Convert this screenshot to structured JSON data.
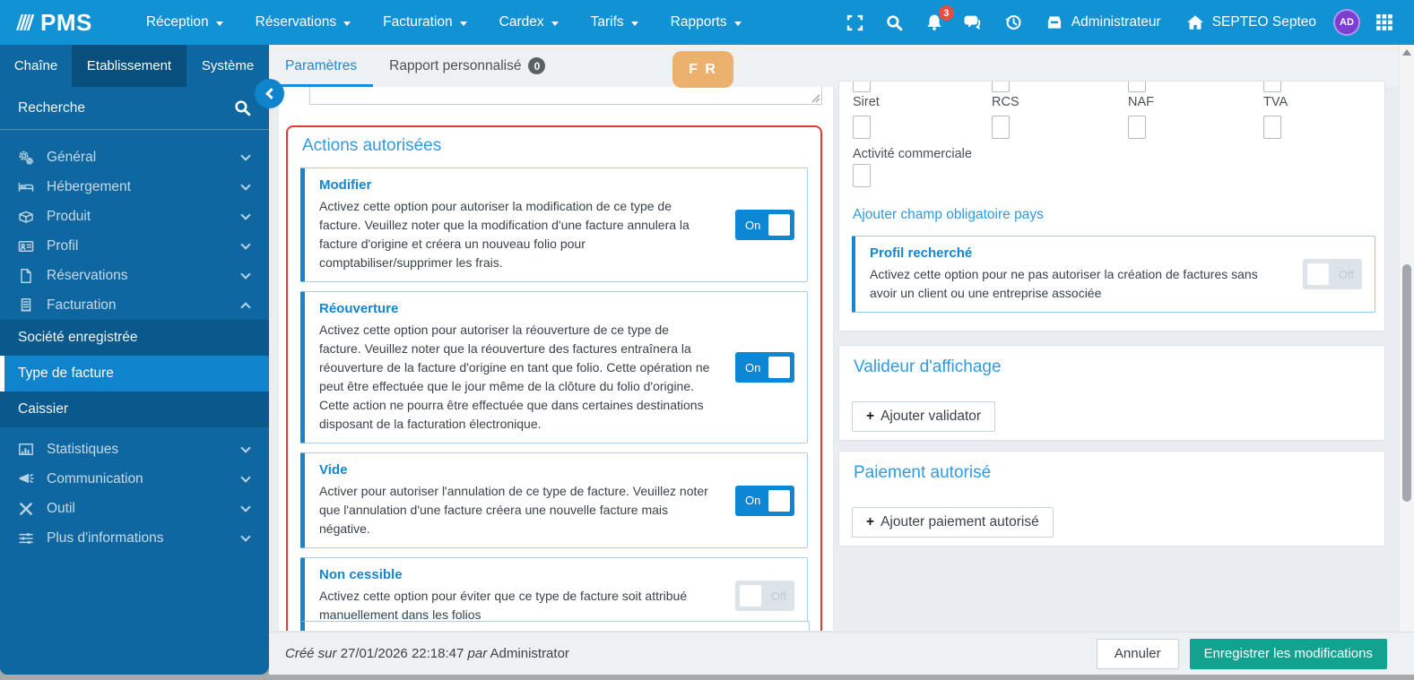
{
  "colors": {
    "navbar_blue": "#1092d4",
    "sidebar_blue": "#0e67a0",
    "accent_blue": "#1486d0",
    "section_title_blue": "#2e9be2",
    "red_highlight": "#e53935",
    "save_teal": "#13a290",
    "language_badge_orange": "#ecb26d",
    "notification_red": "#e84c3d",
    "avatar_purple": "#7a3fd1"
  },
  "icons": {
    "logo-stripes": "diagonal-bars",
    "fullscreen": "corner-brackets",
    "search": "magnifier",
    "notifications": "bell",
    "messages": "chat-bubbles",
    "history": "clock-arrow",
    "user": "inbox-tray",
    "property": "home",
    "apps": "grid-3x3",
    "general": "gears",
    "hebergement": "bed",
    "produit": "open-box",
    "profil": "id-card",
    "reservations": "file",
    "facturation": "receipt",
    "statistiques": "bar-chart",
    "communication": "megaphone",
    "outil": "crossed-tools",
    "plus-informations": "sliders"
  },
  "navbar": {
    "logo_text": "PMS",
    "menus": [
      "Réception",
      "Réservations",
      "Facturation",
      "Cardex",
      "Tarifs",
      "Rapports"
    ],
    "notification_count": "3",
    "user_label": "Administrateur",
    "property_label": "SEPTEO Septeo",
    "avatar_initials": "AD"
  },
  "sidebar": {
    "tabs": [
      "Chaîne",
      "Etablissement",
      "Système"
    ],
    "search_placeholder": "Recherche",
    "items": [
      "Général",
      "Hébergement",
      "Produit",
      "Profil",
      "Réservations",
      "Facturation",
      "Statistiques",
      "Communication",
      "Outil",
      "Plus d'informations"
    ],
    "facturation_children": [
      "Société enregistrée",
      "Type de facture",
      "Caissier"
    ]
  },
  "content_tabs": {
    "parametres": "Paramètres",
    "rapport": "Rapport personnalisé",
    "rapport_badge": "0"
  },
  "language_badge": "F R",
  "actions": {
    "title": "Actions autorisées",
    "cards": [
      {
        "title": "Modifier",
        "description": "Activez cette option pour autoriser la modification de ce type de facture. Veuillez noter que la modification d'une facture annulera la facture d'origine et créera un nouveau folio pour comptabiliser/supprimer les frais.",
        "toggle": "On"
      },
      {
        "title": "Réouverture",
        "description": "Activez cette option pour autoriser la réouverture de ce type de facture. Veuillez noter que la réouverture des factures entraînera la réouverture de la facture d'origine en tant que folio. Cette opération ne peut être effectuée que le jour même de la clôture du folio d'origine. Cette action ne pourra être effectuée que dans certaines destinations disposant de la facturation électronique.",
        "toggle": "On"
      },
      {
        "title": "Vide",
        "description": "Activer pour autoriser l'annulation de ce type de facture. Veuillez noter que l'annulation d'une facture créera une nouvelle facture mais négative.",
        "toggle": "On"
      },
      {
        "title": "Non cessible",
        "description": "Activez cette option pour éviter que ce type de facture soit attribué manuellement dans les folios",
        "toggle": "Off"
      }
    ]
  },
  "company": {
    "field_labels": [
      "Siret",
      "RCS",
      "NAF",
      "TVA"
    ],
    "activity_label": "Activité commerciale",
    "add_country_link": "Ajouter champ obligatoire pays"
  },
  "profil": {
    "title": "Profil recherché",
    "description": "Activez cette option pour ne pas autoriser la création de factures sans avoir un client ou une entreprise associée",
    "toggle": "Off"
  },
  "valideur": {
    "title": "Valideur d'affichage",
    "plus": "+",
    "add_label": "Ajouter validator"
  },
  "paiement": {
    "title": "Paiement autorisé",
    "plus": "+",
    "add_label": "Ajouter paiement autorisé"
  },
  "footer": {
    "created_prefix": "Créé sur",
    "created_date": "27/01/2026 22:18:47",
    "created_by_word": "par",
    "created_by": "Administrator",
    "cancel_label": "Annuler",
    "save_label": "Enregistrer les modifications"
  }
}
